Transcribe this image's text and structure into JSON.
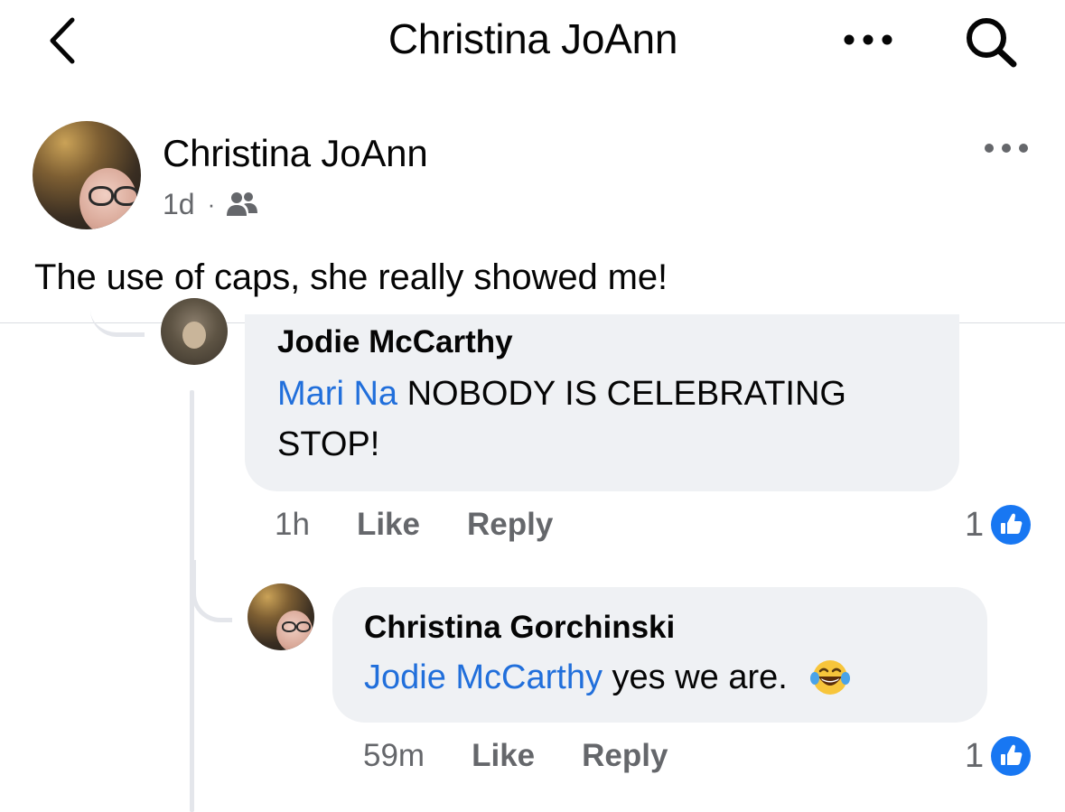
{
  "header": {
    "title": "Christina JoAnn",
    "back_icon": "chevron-left-icon",
    "more_icon": "more-horizontal-icon",
    "search_icon": "search-icon"
  },
  "post": {
    "author": "Christina JoAnn",
    "time": "1d",
    "separator": "·",
    "audience_icon": "friends-icon",
    "more_icon": "more-horizontal-icon",
    "text": "The use of caps, she really showed me!"
  },
  "comments": [
    {
      "author": "Jodie McCarthy",
      "mention": "Mari Na",
      "text": " NOBODY IS CELEBRATING STOP!",
      "time": "1h",
      "like_label": "Like",
      "reply_label": "Reply",
      "like_count": "1",
      "reaction_icon": "thumbs-up-icon"
    },
    {
      "author": "Christina Gorchinski",
      "mention": "Jodie McCarthy",
      "text": " yes we are.",
      "emoji_icon": "laughing-tears-emoji-icon",
      "time": "59m",
      "like_label": "Like",
      "reply_label": "Reply",
      "like_count": "1",
      "reaction_icon": "thumbs-up-icon"
    }
  ],
  "colors": {
    "mention": "#216fdb",
    "secondary_text": "#65676b",
    "bubble": "#eff1f4",
    "like_blue": "#1877f2"
  }
}
